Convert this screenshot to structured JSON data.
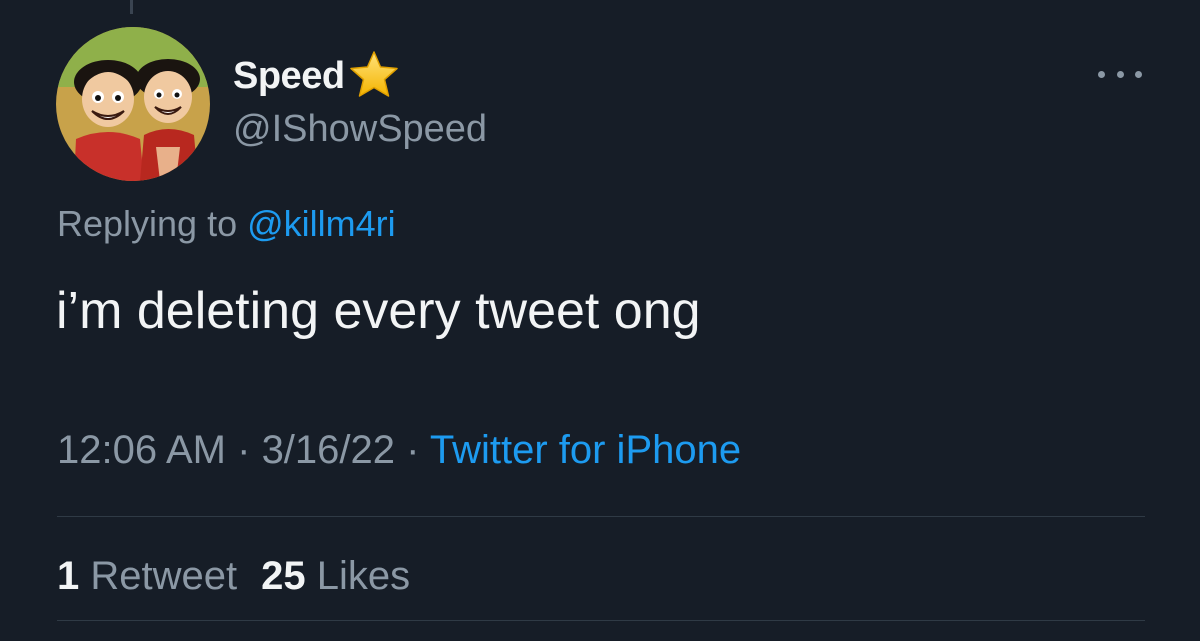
{
  "tweet": {
    "display_name": "Speed",
    "handle": "@IShowSpeed",
    "replying_prefix": "Replying to ",
    "replying_to": "@killm4ri",
    "text": "i’m deleting every tweet ong",
    "time": "12:06 AM",
    "separator": " · ",
    "date": "3/16/22",
    "source": "Twitter for iPhone",
    "retweet_count": "1",
    "retweet_label": "Retweet",
    "like_count": "25",
    "like_label": "Likes"
  },
  "icons": {
    "badge": "star-icon",
    "menu": "more-icon"
  },
  "colors": {
    "background": "#161d27",
    "accent": "#1d9bf0",
    "secondary_text": "#8b98a5",
    "primary_text": "#f2f4f5"
  }
}
